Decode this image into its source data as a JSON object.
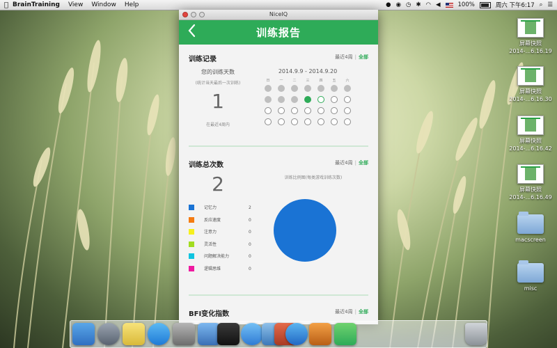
{
  "menubar": {
    "app_name": "BrainTraining",
    "items": [
      "View",
      "Window",
      "Help"
    ],
    "battery": "100%",
    "datetime": "周六 下午6:17"
  },
  "desktop_icons": [
    {
      "kind": "screenshot",
      "line1": "屏幕快照",
      "line2": "2014-...6.16.19"
    },
    {
      "kind": "screenshot",
      "line1": "屏幕快照",
      "line2": "2014-...6.16.30"
    },
    {
      "kind": "screenshot",
      "line1": "屏幕快照",
      "line2": "2014-...6.16.42"
    },
    {
      "kind": "screenshot",
      "line1": "屏幕快照",
      "line2": "2014-...6.16.49"
    },
    {
      "kind": "folder",
      "line1": "macscreen",
      "line2": ""
    },
    {
      "kind": "folder",
      "line1": "misc",
      "line2": ""
    }
  ],
  "window": {
    "title": "NiceIQ",
    "header_title": "训练报告",
    "back_label": "<"
  },
  "training_record": {
    "title": "训练记录",
    "filter_recent": "最近4周",
    "filter_sep": "|",
    "filter_all": "全部",
    "days_label": "您的训练天数",
    "days_note": "(统计当天最后一次训练)",
    "days_value": "1",
    "days_period": "在最近4周内",
    "date_range": "2014.9.9 - 2014.9.20",
    "weekdays": [
      "日",
      "一",
      "二",
      "三",
      "四",
      "五",
      "六"
    ],
    "calendar": [
      [
        "filled",
        "filled",
        "filled",
        "filled",
        "filled",
        "filled",
        "filled"
      ],
      [
        "filled",
        "filled",
        "filled",
        "today",
        "current",
        "empty",
        "empty"
      ],
      [
        "empty",
        "empty",
        "empty",
        "empty",
        "empty",
        "empty",
        "empty"
      ],
      [
        "empty",
        "empty",
        "empty",
        "empty",
        "empty",
        "empty",
        "empty"
      ]
    ]
  },
  "total_sessions": {
    "title": "训练总次数",
    "filter_recent": "最近4周",
    "filter_sep": "|",
    "filter_all": "全部",
    "value": "2",
    "chart_caption": "训练比例图(每类游戏训练次数)",
    "categories": [
      {
        "name": "记忆力",
        "count": "2",
        "color": "#1a73d4"
      },
      {
        "name": "反应速度",
        "count": "0",
        "color": "#f57c12"
      },
      {
        "name": "注意力",
        "count": "0",
        "color": "#f6f01e"
      },
      {
        "name": "灵活性",
        "count": "0",
        "color": "#a2dc20"
      },
      {
        "name": "问题解决能力",
        "count": "0",
        "color": "#10c4e0"
      },
      {
        "name": "逻辑思维",
        "count": "0",
        "color": "#ee1aa0"
      }
    ]
  },
  "bfi": {
    "title": "BFI变化指数",
    "filter_recent": "最近4周",
    "filter_sep": "|",
    "filter_all": "全部"
  },
  "chart_data": {
    "type": "pie",
    "title": "训练比例图(每类游戏训练次数)",
    "categories": [
      "记忆力",
      "反应速度",
      "注意力",
      "灵活性",
      "问题解决能力",
      "逻辑思维"
    ],
    "values": [
      2,
      0,
      0,
      0,
      0,
      0
    ],
    "colors": [
      "#1a73d4",
      "#f57c12",
      "#f6f01e",
      "#a2dc20",
      "#10c4e0",
      "#ee1aa0"
    ]
  },
  "dock": {
    "items": [
      "finder-icon",
      "launchpad-icon",
      "stickies-icon",
      "appstore-icon",
      "system-preferences-icon",
      "xcode-icon",
      "terminal-icon",
      "safari-icon",
      "preview-icon",
      "instruments-icon",
      "itunes-icon",
      "sublime-icon",
      "niceiq-icon",
      "trash-icon"
    ]
  }
}
